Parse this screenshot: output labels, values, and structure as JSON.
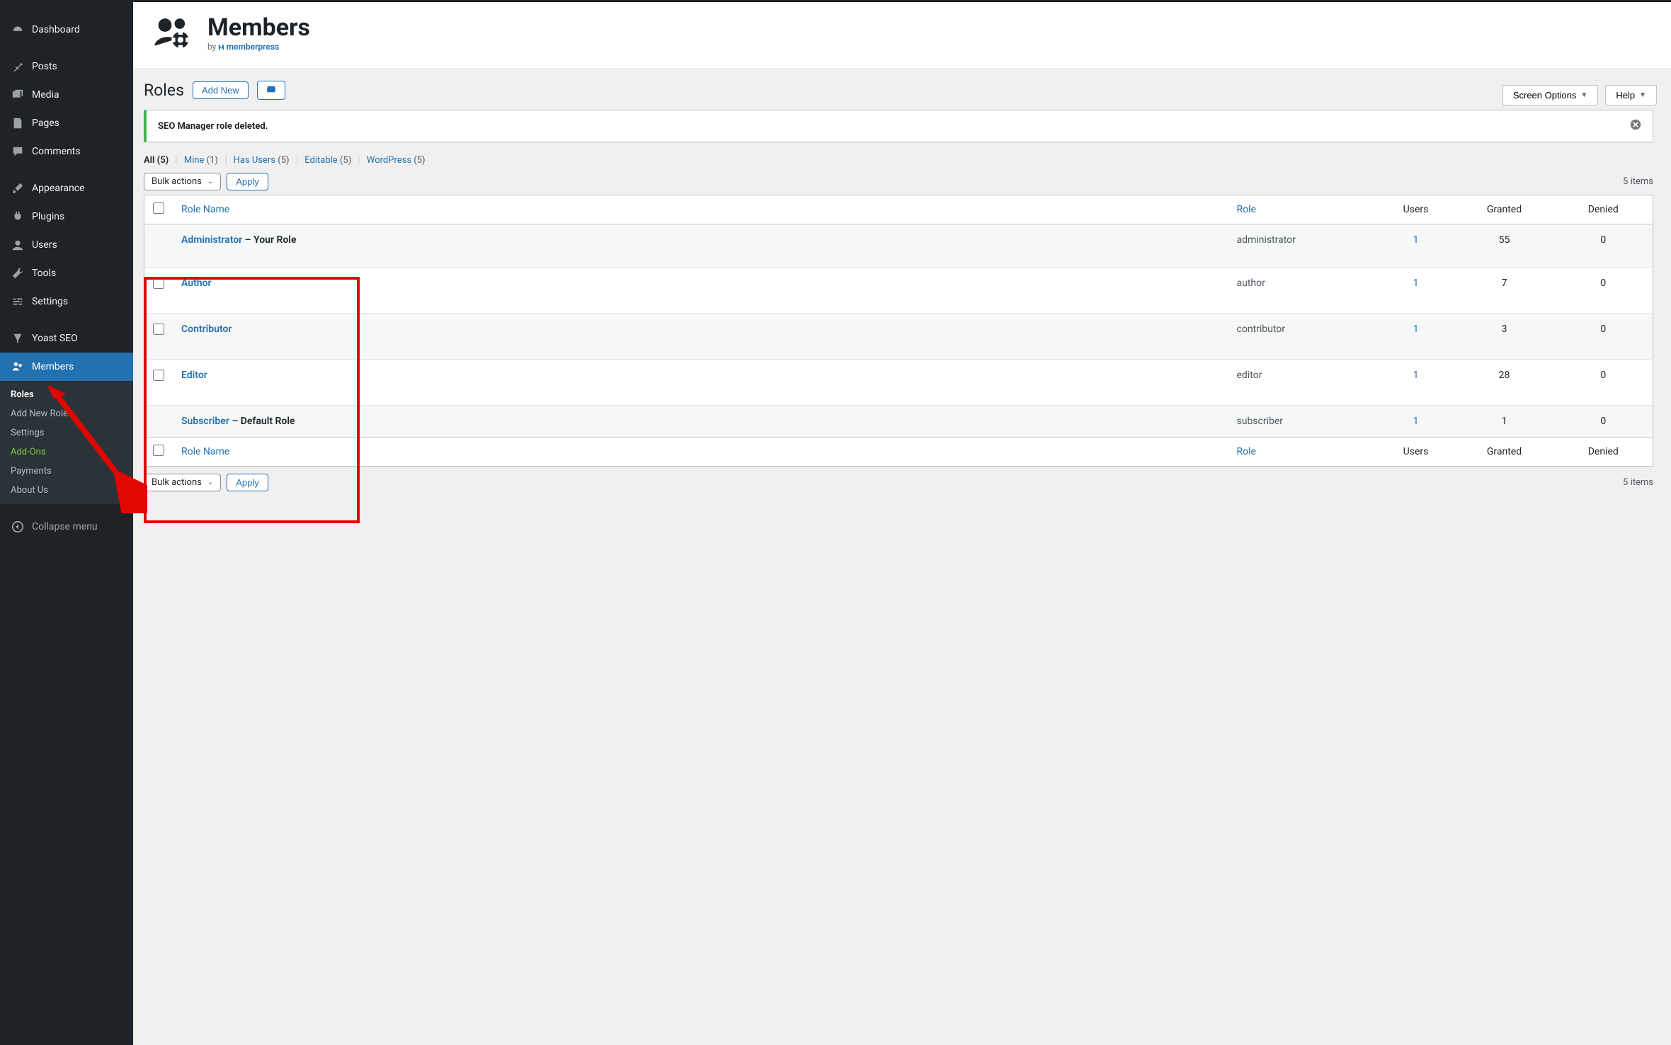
{
  "sidebar": {
    "items": [
      {
        "label": "Dashboard"
      },
      {
        "label": "Posts"
      },
      {
        "label": "Media"
      },
      {
        "label": "Pages"
      },
      {
        "label": "Comments"
      },
      {
        "label": "Appearance"
      },
      {
        "label": "Plugins"
      },
      {
        "label": "Users"
      },
      {
        "label": "Tools"
      },
      {
        "label": "Settings"
      },
      {
        "label": "Yoast SEO"
      },
      {
        "label": "Members"
      }
    ],
    "submenu": [
      {
        "label": "Roles"
      },
      {
        "label": "Add New Role"
      },
      {
        "label": "Settings"
      },
      {
        "label": "Add-Ons"
      },
      {
        "label": "Payments"
      },
      {
        "label": "About Us"
      }
    ],
    "collapse": "Collapse menu"
  },
  "banner": {
    "title": "Members",
    "byline_prefix": "by",
    "byline_brand": "memberpress"
  },
  "screen_meta": {
    "screen_options": "Screen Options",
    "help": "Help"
  },
  "page": {
    "title": "Roles",
    "add_new": "Add New"
  },
  "notice": {
    "message": "SEO Manager role deleted."
  },
  "filters": {
    "all_label": "All",
    "all_count": "(5)",
    "mine_label": "Mine",
    "mine_count": "(1)",
    "hasusers_label": "Has Users",
    "hasusers_count": "(5)",
    "editable_label": "Editable",
    "editable_count": "(5)",
    "wordpress_label": "WordPress",
    "wordpress_count": "(5)"
  },
  "bulk": {
    "label": "Bulk actions",
    "apply": "Apply"
  },
  "items_count": "5 items",
  "columns": {
    "role_name": "Role Name",
    "role": "Role",
    "users": "Users",
    "granted": "Granted",
    "denied": "Denied"
  },
  "roles": [
    {
      "name": "Administrator",
      "suffix": " – Your Role",
      "slug": "administrator",
      "users": "1",
      "granted": "55",
      "denied": "0",
      "checkbox": false
    },
    {
      "name": "Author",
      "suffix": "",
      "slug": "author",
      "users": "1",
      "granted": "7",
      "denied": "0",
      "checkbox": true
    },
    {
      "name": "Contributor",
      "suffix": "",
      "slug": "contributor",
      "users": "1",
      "granted": "3",
      "denied": "0",
      "checkbox": true
    },
    {
      "name": "Editor",
      "suffix": "",
      "slug": "editor",
      "users": "1",
      "granted": "28",
      "denied": "0",
      "checkbox": true
    },
    {
      "name": "Subscriber",
      "suffix": " – Default Role",
      "slug": "subscriber",
      "users": "1",
      "granted": "1",
      "denied": "0",
      "checkbox": false
    }
  ]
}
